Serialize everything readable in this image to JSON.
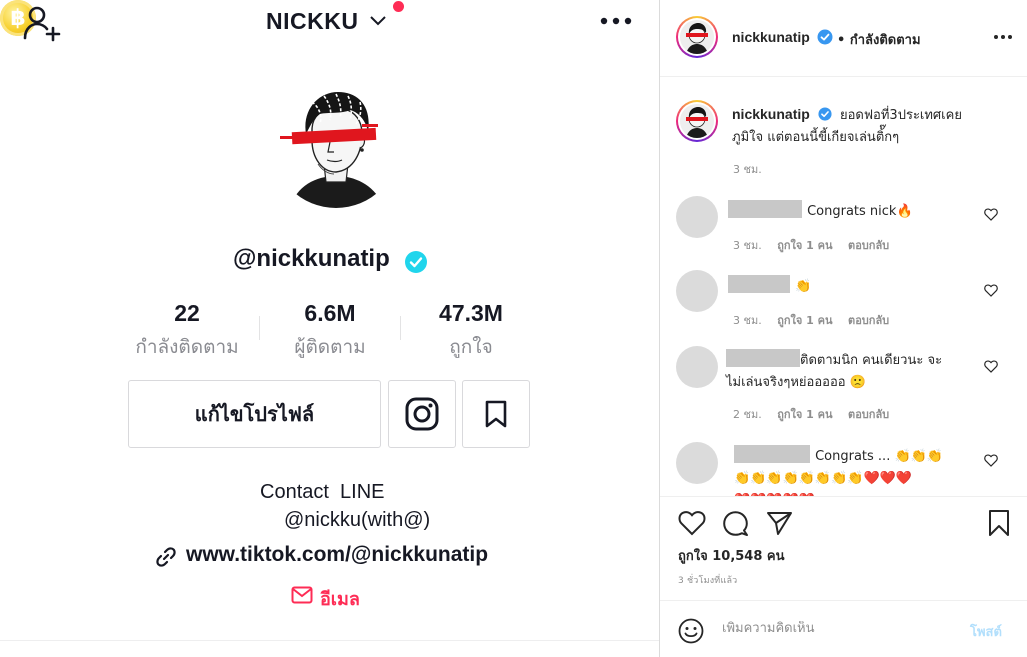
{
  "tiktok": {
    "username_top": "NICKKU",
    "handle": "@nickkunatip",
    "coin_symbol": "฿",
    "stats": [
      {
        "value": "22",
        "label": "กำลังติดตาม"
      },
      {
        "value": "6.6M",
        "label": "ผู้ติดตาม"
      },
      {
        "value": "47.3M",
        "label": "ถูกใจ"
      }
    ],
    "edit_profile_label": "แก้ไขโปรไฟล์",
    "bio_line1": "Contact  LINE",
    "bio_line2": "@nickku(with@)",
    "link": "www.tiktok.com/@nickkunatip",
    "email_label": "อีเมล",
    "colors": {
      "accent": "#fe2c55",
      "verified": "#20d5ec",
      "text": "#161823"
    }
  },
  "instagram": {
    "header": {
      "username": "nickkunatip",
      "follow_status": "• กำลังติดตาม"
    },
    "caption": {
      "username": "nickkunatip",
      "text_line1": "ยอดฟอที่3ประเทศเคย",
      "text_line2": "ภูมิใจ แต่ตอนนี้ขี้เกียจเล่นติ้๊กๆ",
      "time": "3 ชม."
    },
    "comments": [
      {
        "text": "Congrats nick🔥",
        "time": "3 ชม.",
        "likes": "ถูกใจ 1 คน",
        "reply": "ตอบกลับ"
      },
      {
        "text": "👏",
        "time": "3 ชม.",
        "likes": "ถูกใจ 1 คน",
        "reply": "ตอบกลับ"
      },
      {
        "text_line1": "ติดตามนิก คนเดียวนะ จะ",
        "text_line2": "ไม่เล่นจริงๆหย่อออออ 🙁",
        "time": "2 ชม.",
        "likes": "ถูกใจ 1 คน",
        "reply": "ตอบกลับ"
      },
      {
        "text_line1": "Congrats ... 👏👏👏",
        "text_line2": "👏👏👏👏👏👏👏👏❤️❤️❤️",
        "text_line3": "❤️❤️❤️❤️❤️"
      }
    ],
    "likes_label": "ถูกใจ 10,548 คน",
    "time_ago": "3 ชั่วโมงที่แล้ว",
    "comment_placeholder": "เพิ่มความคิดเห็น",
    "post_label": "โพสต์",
    "colors": {
      "verified": "#3897f0",
      "muted": "#8e8e8e",
      "post_disabled": "#b2dffc"
    }
  }
}
